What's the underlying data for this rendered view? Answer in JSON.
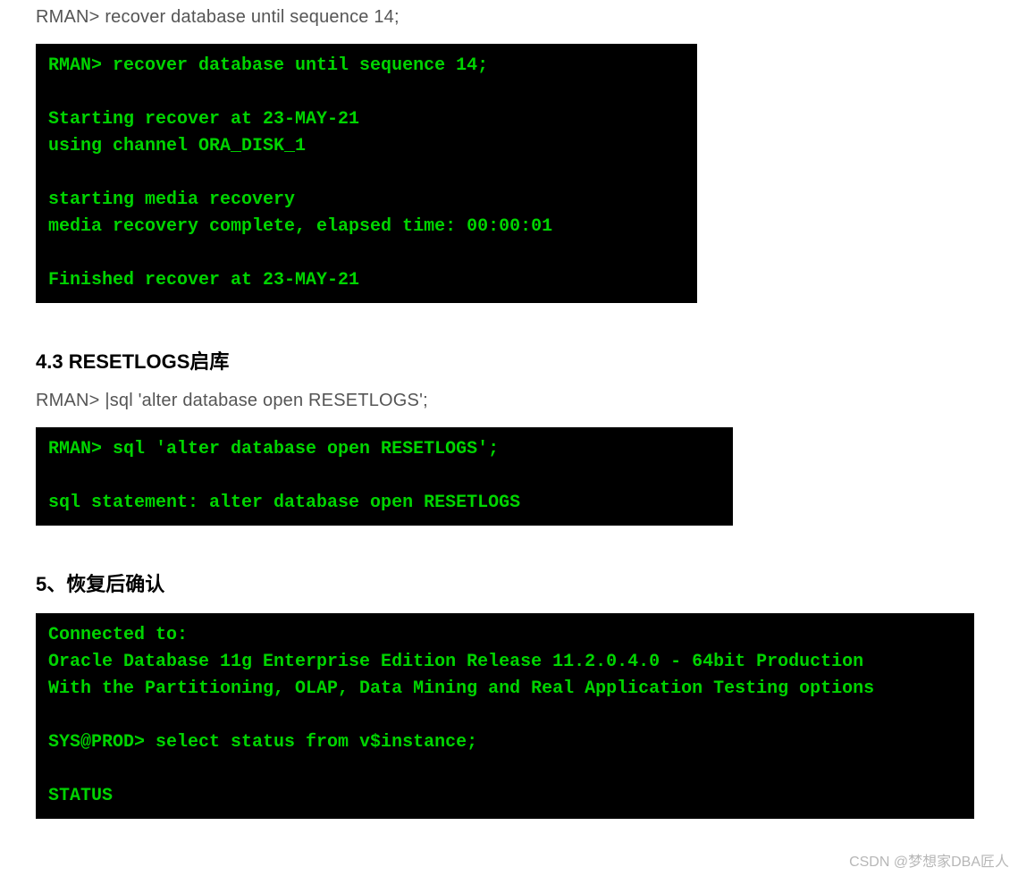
{
  "cmd_recover": "RMAN> recover database until sequence 14;",
  "terminal_recover": "RMAN> recover database until sequence 14;\n\nStarting recover at 23-MAY-21\nusing channel ORA_DISK_1\n\nstarting media recovery\nmedia recovery complete, elapsed time: 00:00:01\n\nFinished recover at 23-MAY-21",
  "heading_43": "4.3 RESETLOGS启库",
  "cmd_resetlogs_prefix": "RMAN> ",
  "cmd_resetlogs_rest": "sql 'alter database open RESETLOGS';",
  "terminal_resetlogs": "RMAN> sql 'alter database open RESETLOGS';\n\nsql statement: alter database open RESETLOGS",
  "heading_5": "5、恢复后确认",
  "terminal_confirm": "Connected to:\nOracle Database 11g Enterprise Edition Release 11.2.0.4.0 - 64bit Production\nWith the Partitioning, OLAP, Data Mining and Real Application Testing options\n\nSYS@PROD> select status from v$instance;\n\nSTATUS",
  "watermark": "CSDN @梦想家DBA匠人"
}
